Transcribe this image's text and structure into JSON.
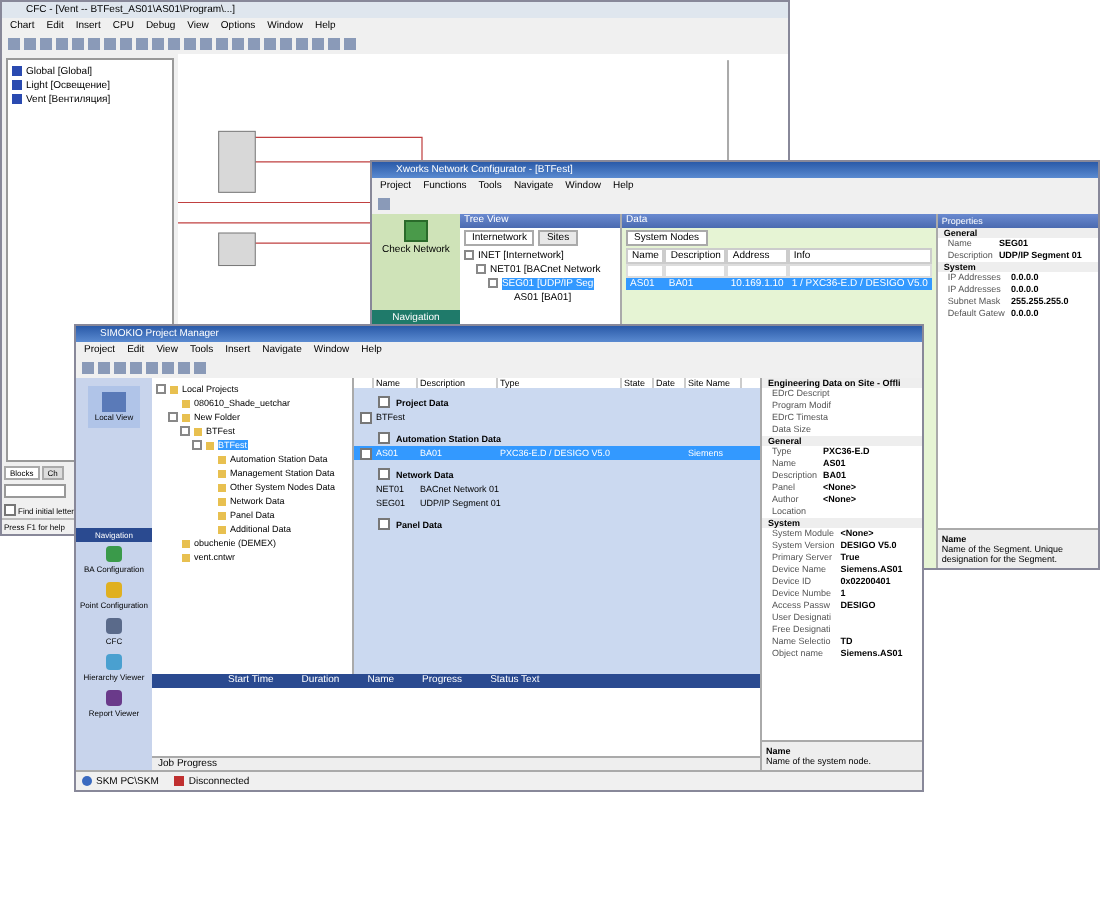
{
  "cfc_window": {
    "title": "CFC - [Vent -- BTFest_AS01\\AS01\\Program\\...]",
    "menu": [
      "Chart",
      "Edit",
      "Insert",
      "CPU",
      "Debug",
      "View",
      "Options",
      "Window",
      "Help"
    ],
    "tree": [
      {
        "label": "Global [Global]"
      },
      {
        "label": "Light [Освещение]"
      },
      {
        "label": "Vent [Вентиляция]"
      }
    ],
    "tabs": [
      {
        "label": "Blocks",
        "selected": true
      },
      {
        "label": "Ch",
        "selected": false
      }
    ],
    "find_initial_letter": {
      "label": "Find initial letter",
      "checked": false
    },
    "status_text": "Press F1 for help"
  },
  "network_configurator": {
    "title": "Xworks Network Configurator - [BTFest]",
    "menu": [
      "Project",
      "Functions",
      "Tools",
      "Navigate",
      "Window",
      "Help"
    ],
    "check_network": "Check Network",
    "navigation": "Navigation",
    "tree_view": {
      "title": "Tree View",
      "tabs": [
        {
          "label": "Internetwork",
          "selected": true
        },
        {
          "label": "Sites",
          "selected": false
        }
      ],
      "tree": [
        {
          "label": "INET [Internetwork]",
          "selected": false,
          "children": [
            {
              "label": "NET01 [BACnet Network",
              "selected": false,
              "children": [
                {
                  "label": "SEG01 [UDP/IP Seg",
                  "selected": true,
                  "children": [
                    {
                      "label": "AS01 [BA01]",
                      "selected": false
                    }
                  ]
                }
              ]
            }
          ]
        }
      ]
    },
    "data": {
      "title": "Data",
      "tab": "System Nodes",
      "columns": [
        "Name",
        "Description",
        "Address",
        "Info"
      ],
      "rows": [
        {
          "cells": [
            "AS01",
            "BA01",
            "10.169.1.10",
            "1 / PXC36-E.D / DESIGO V5.0"
          ],
          "selected": true
        }
      ]
    },
    "properties": {
      "title": "Properties",
      "groups": [
        {
          "name": "General",
          "rows": [
            [
              "Name",
              "SEG01"
            ],
            [
              "Description",
              "UDP/IP Segment 01"
            ]
          ]
        },
        {
          "name": "System",
          "rows": [
            [
              "IP Addresses",
              "0.0.0.0"
            ],
            [
              "IP Addresses",
              "0.0.0.0"
            ],
            [
              "Subnet Mask",
              "255.255.255.0"
            ],
            [
              "Default Gatew",
              "0.0.0.0"
            ]
          ]
        }
      ],
      "help_title": "Name",
      "help_text": "Name of the Segment. Unique designation for the Segment."
    }
  },
  "project_manager": {
    "title": "SIMOKIO Project Manager",
    "menu": [
      "Project",
      "Edit",
      "View",
      "Tools",
      "Insert",
      "Navigate",
      "Window",
      "Help"
    ],
    "local_view": "Local View",
    "navigation": "Navigation",
    "nav_items": [
      {
        "label": "BA Configuration",
        "color": "#3a9a4a"
      },
      {
        "label": "Point Configuration",
        "color": "#e0b020"
      },
      {
        "label": "CFC",
        "color": "#5a6a8a"
      },
      {
        "label": "Hierarchy Viewer",
        "color": "#4aa0d0"
      },
      {
        "label": "Report Viewer",
        "color": "#6a3a8a"
      }
    ],
    "tree": [
      {
        "label": "Local Projects",
        "selected": false,
        "children": [
          {
            "label": "080610_Shade_uetchar",
            "selected": false
          },
          {
            "label": "New Folder",
            "selected": false,
            "children": [
              {
                "label": "BTFest",
                "selected": false,
                "children": [
                  {
                    "label": "BTFest",
                    "selected": true,
                    "children": [
                      {
                        "label": "Automation Station Data",
                        "selected": false
                      },
                      {
                        "label": "Management Station Data",
                        "selected": false
                      },
                      {
                        "label": "Other System Nodes Data",
                        "selected": false
                      },
                      {
                        "label": "Network Data",
                        "selected": false
                      },
                      {
                        "label": "Panel Data",
                        "selected": false
                      },
                      {
                        "label": "Additional Data",
                        "selected": false
                      }
                    ]
                  }
                ]
              }
            ]
          },
          {
            "label": "obuchenie (DEMEX)",
            "selected": false
          },
          {
            "label": "vent.cntwr",
            "selected": false
          }
        ]
      }
    ],
    "columns": [
      "Name",
      "Description",
      "Type",
      "State",
      "Date",
      "Site Name"
    ],
    "rows": [
      {
        "kind": "group",
        "cells": [
          "Project Data"
        ],
        "checked": false
      },
      {
        "kind": "item",
        "cells": [
          "BTFest",
          "",
          "",
          "",
          "",
          ""
        ],
        "selected": false,
        "checkbox": true
      },
      {
        "kind": "group",
        "cells": [
          "Automation Station Data"
        ],
        "checked": false
      },
      {
        "kind": "item",
        "cells": [
          "AS01",
          "BA01",
          "PXC36-E.D / DESIGO V5.0",
          "",
          "",
          "Siemens"
        ],
        "selected": true,
        "checkbox": true
      },
      {
        "kind": "group",
        "cells": [
          "Network Data"
        ],
        "checked": false
      },
      {
        "kind": "item",
        "cells": [
          "NET01",
          "BACnet Network 01",
          "",
          "",
          "",
          ""
        ],
        "selected": false,
        "checkbox": false
      },
      {
        "kind": "item",
        "cells": [
          "SEG01",
          "UDP/IP Segment 01",
          "",
          "",
          "",
          ""
        ],
        "selected": false,
        "checkbox": false
      },
      {
        "kind": "group",
        "cells": [
          "Panel Data"
        ],
        "checked": false
      }
    ],
    "properties": [
      {
        "name": "Engineering Data on Site - Offli",
        "rows": [
          [
            "EDrC Descript",
            ""
          ],
          [
            "Program Modif",
            ""
          ],
          [
            "EDrC Timesta",
            ""
          ],
          [
            "Data Size",
            ""
          ]
        ]
      },
      {
        "name": "General",
        "rows": [
          [
            "Type",
            "PXC36-E.D"
          ],
          [
            "Name",
            "AS01"
          ],
          [
            "Description",
            "BA01"
          ],
          [
            "Panel",
            "<None>"
          ],
          [
            "Author",
            "<None>"
          ],
          [
            "Location",
            ""
          ]
        ]
      },
      {
        "name": "System",
        "rows": [
          [
            "System Module",
            "<None>"
          ],
          [
            "System Version",
            "DESIGO V5.0"
          ],
          [
            "Primary Server",
            "True"
          ],
          [
            "Device Name",
            "Siemens.AS01"
          ],
          [
            "Device ID",
            "0x02200401"
          ],
          [
            "Device Numbe",
            "1"
          ],
          [
            "Access Passw",
            "DESIGO"
          ],
          [
            "User Designati",
            ""
          ],
          [
            "Free Designati",
            ""
          ],
          [
            "Name Selectio",
            "TD"
          ],
          [
            "Object name",
            "Siemens.AS01"
          ]
        ]
      }
    ],
    "help_title": "Name",
    "help_text": "Name of the system node.",
    "job_columns": [
      "Start Time",
      "Duration",
      "Name",
      "Progress",
      "Status Text"
    ],
    "job_tab": "Job Progress",
    "status": [
      {
        "label": "SKM PC\\SKM",
        "kind": "user"
      },
      {
        "label": "Disconnected",
        "kind": "connection"
      }
    ]
  }
}
